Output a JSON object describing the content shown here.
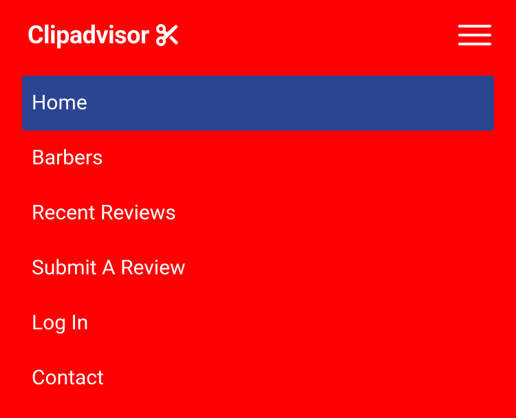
{
  "header": {
    "brand_text": "Clipadvisor"
  },
  "nav": {
    "items": [
      {
        "label": "Home",
        "active": true
      },
      {
        "label": "Barbers",
        "active": false
      },
      {
        "label": "Recent Reviews",
        "active": false
      },
      {
        "label": "Submit A Review",
        "active": false
      },
      {
        "label": "Log In",
        "active": false
      },
      {
        "label": "Contact",
        "active": false
      }
    ]
  }
}
